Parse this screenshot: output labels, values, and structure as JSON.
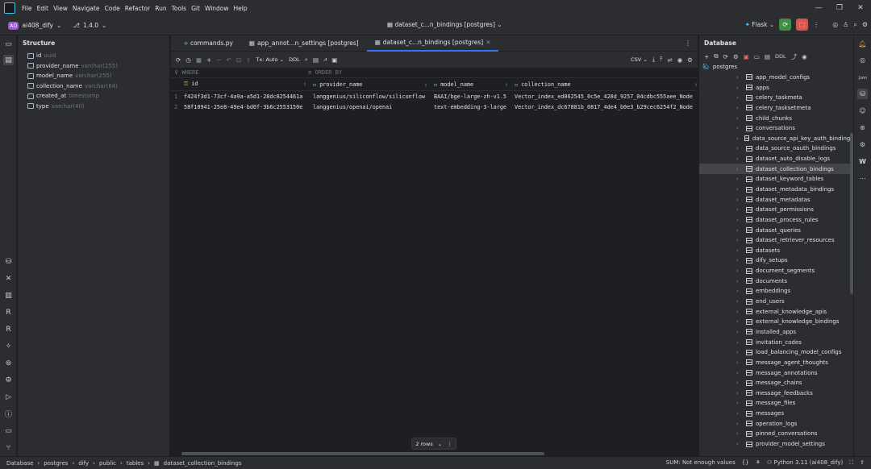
{
  "menubar": {
    "items": [
      "File",
      "Edit",
      "View",
      "Navigate",
      "Code",
      "Refactor",
      "Run",
      "Tools",
      "Git",
      "Window",
      "Help"
    ]
  },
  "toolbar": {
    "project_badge": "AD",
    "project_name": "ai408_dify",
    "vcs_version": "1.4.0",
    "title": "dataset_c...n_bindings [postgres]",
    "run_config": "Flask"
  },
  "structure": {
    "title": "Structure",
    "columns": [
      {
        "name": "id",
        "type": "uuid"
      },
      {
        "name": "provider_name",
        "type": "varchar(255)"
      },
      {
        "name": "model_name",
        "type": "varchar(255)"
      },
      {
        "name": "collection_name",
        "type": "varchar(64)"
      },
      {
        "name": "created_at",
        "type": "timestamp"
      },
      {
        "name": "type",
        "type": "varchar(40)"
      }
    ]
  },
  "editor": {
    "tabs": [
      {
        "label": "commands.py",
        "active": false
      },
      {
        "label": "app_annot...n_settings [postgres]",
        "active": false
      },
      {
        "label": "dataset_c...n_bindings [postgres]",
        "active": true
      }
    ],
    "tx_mode": "Tx: Auto",
    "ddl": "DDL",
    "export_format": "CSV",
    "where_placeholder": "WHERE",
    "order_by_placeholder": "ORDER BY"
  },
  "grid": {
    "headers": [
      "id",
      "provider_name",
      "model_name",
      "collection_name"
    ],
    "rows": [
      {
        "num": "1",
        "cells": [
          "f424f3d1-73cf-4a9a-a5d1-28dc8254461a",
          "langgenius/siliconflow/siliconflow",
          "BAAI/bge-large-zh-v1.5",
          "Vector_index_ed062545_0c5e_428d_9257_04cdbc555aee_Node"
        ]
      },
      {
        "num": "2",
        "cells": [
          "58f10941-25e8-49e4-bd0f-3b6c2553150e",
          "langgenius/openai/openai",
          "text-embedding-3-large",
          "Vector_index_dc67881b_0817_4de4_b0e3_b29cec6254f2_Node"
        ]
      }
    ],
    "rows_badge": "2 rows"
  },
  "database": {
    "title": "Database",
    "root": "postgres",
    "ddl": "DDL",
    "tables": [
      "app_model_configs",
      "apps",
      "celery_taskmeta",
      "celery_tasksetmeta",
      "child_chunks",
      "conversations",
      "data_source_api_key_auth_bindings",
      "data_source_oauth_bindings",
      "dataset_auto_disable_logs",
      "dataset_collection_bindings",
      "dataset_keyword_tables",
      "dataset_metadata_bindings",
      "dataset_metadatas",
      "dataset_permissions",
      "dataset_process_rules",
      "dataset_queries",
      "dataset_retriever_resources",
      "datasets",
      "dify_setups",
      "document_segments",
      "documents",
      "embeddings",
      "end_users",
      "external_knowledge_apis",
      "external_knowledge_bindings",
      "installed_apps",
      "invitation_codes",
      "load_balancing_model_configs",
      "message_agent_thoughts",
      "message_annotations",
      "message_chains",
      "message_feedbacks",
      "message_files",
      "messages",
      "operation_logs",
      "pinned_conversations",
      "provider_model_settings"
    ],
    "selected": "dataset_collection_bindings"
  },
  "status": {
    "breadcrumbs": [
      "Database",
      "postgres",
      "dify",
      "public",
      "tables",
      "dataset_collection_bindings"
    ],
    "sum": "SUM: Not enough values",
    "braces": "{}",
    "interpreter": "Python 3.11 (ai408_dify)"
  },
  "rstrip": {
    "json_label": "Json"
  }
}
